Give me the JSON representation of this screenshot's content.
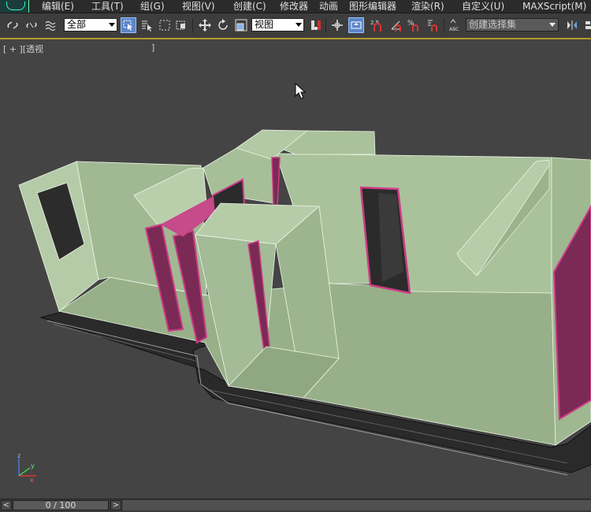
{
  "menubar": {
    "items": [
      "编辑(E)",
      "工具(T)",
      "组(G)",
      "视图(V)",
      "创建(C)",
      "修改器",
      "动画",
      "图形编辑器",
      "渲染(R)",
      "自定义(U)",
      "MAXScript(M)"
    ]
  },
  "toolbar": {
    "selection_filter": "全部",
    "reference_coord": "视图",
    "named_selection_placeholder": "创建选择集",
    "snap_25": "2.5",
    "percent_snap": "%",
    "abc": "ABC"
  },
  "viewport": {
    "label": "[ + ][透视",
    "label_end": "]",
    "axis": {
      "z": "z",
      "x": "x",
      "y": "y"
    }
  },
  "timeline": {
    "frame": "0 / 100",
    "prev": "<",
    "next": ">"
  },
  "colors": {
    "wall": "#a9c29b",
    "floor": "#97b089",
    "door_frame": "#b0326e",
    "edge": "#ffffff",
    "accent": "#b39a2b"
  }
}
